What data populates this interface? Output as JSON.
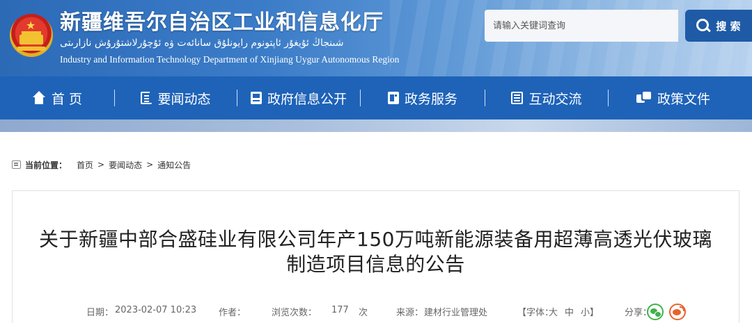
{
  "header": {
    "site_title": "新疆维吾尔自治区工业和信息化厅",
    "site_title_uyghur": "شىنجاڭ ئۇيغۇر ئاپتونوم رايونلۇق سانائەت ۋە ئۇچۇرلاشتۇرۇش نازارىتى",
    "site_title_english": "Industry and Information Technology Department of Xinjiang Uygur Autonomous Region",
    "search_placeholder": "请输入关键词查询",
    "search_button_label": "搜 索"
  },
  "nav": {
    "items": [
      {
        "label": "首 页",
        "icon": "home-icon"
      },
      {
        "label": "要闻动态",
        "icon": "news-icon"
      },
      {
        "label": "政府信息公开",
        "icon": "gov-info-icon"
      },
      {
        "label": "政务服务",
        "icon": "service-icon"
      },
      {
        "label": "互动交流",
        "icon": "interaction-icon"
      },
      {
        "label": "政策文件",
        "icon": "policy-icon"
      }
    ]
  },
  "breadcrumb": {
    "label": "当前位置：",
    "items": [
      "首页",
      "要闻动态",
      "通知公告"
    ],
    "separator": ">"
  },
  "article": {
    "title_line1": "关于新疆中部合盛硅业有限公司年产150万吨新能源装备用超薄高透光伏玻璃",
    "title_line2": "制造项目信息的公告",
    "meta": {
      "date_label": "日期：",
      "date": "2023-02-07 10:23",
      "author_label": "作者：",
      "views_label": "浏览次数：",
      "views": "177",
      "views_unit": "次",
      "source_label": "来源：",
      "source": "建材行业管理处",
      "font_size_label": "【字体：",
      "font_large": "大",
      "font_medium": "中",
      "font_small": "小】",
      "share_label": "分享："
    }
  },
  "colors": {
    "nav_blue": "#1e63b8",
    "search_button": "#1f5aa6",
    "wechat_green": "#3fb24a",
    "weibo_orange": "#e8632d"
  }
}
